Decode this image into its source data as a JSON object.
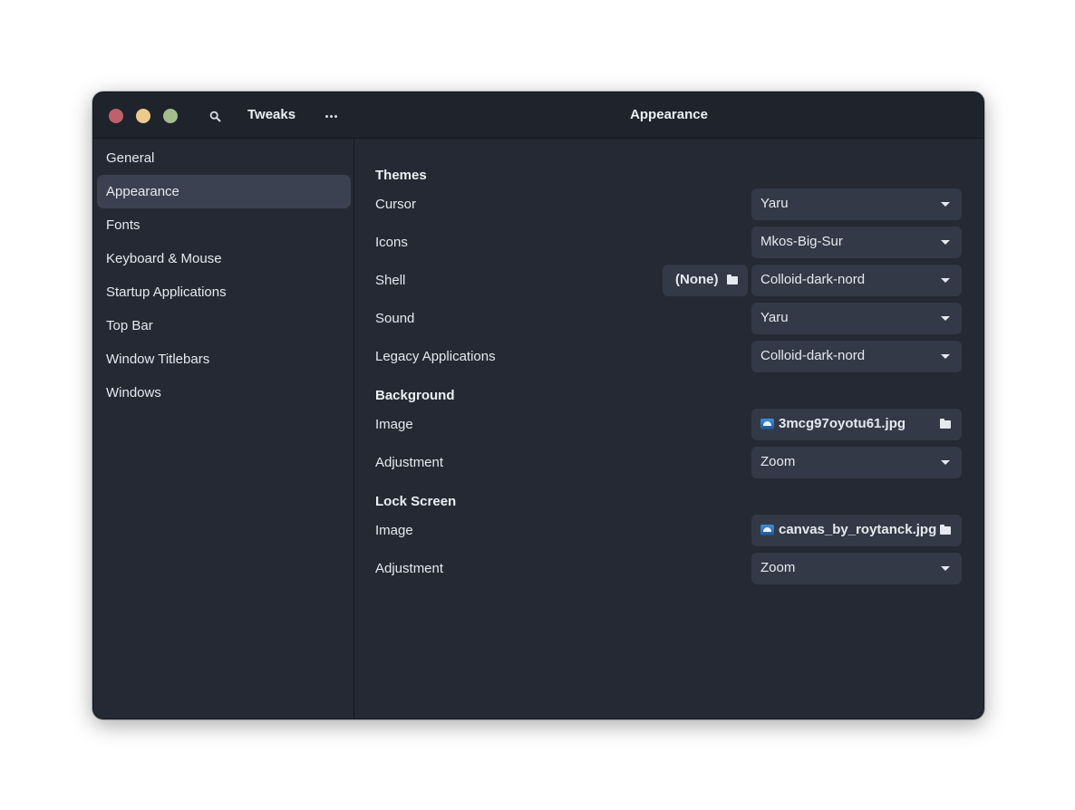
{
  "window": {
    "app_title": "Tweaks",
    "page_title": "Appearance"
  },
  "sidebar": {
    "items": [
      {
        "label": "General"
      },
      {
        "label": "Appearance"
      },
      {
        "label": "Fonts"
      },
      {
        "label": "Keyboard & Mouse"
      },
      {
        "label": "Startup Applications"
      },
      {
        "label": "Top Bar"
      },
      {
        "label": "Window Titlebars"
      },
      {
        "label": "Windows"
      }
    ],
    "selected": "Appearance"
  },
  "themes": {
    "heading": "Themes",
    "cursor": {
      "label": "Cursor",
      "value": "Yaru"
    },
    "icons": {
      "label": "Icons",
      "value": "Mkos-Big-Sur"
    },
    "shell": {
      "label": "Shell",
      "value": "Colloid-dark-nord",
      "file_button": "(None)"
    },
    "sound": {
      "label": "Sound",
      "value": "Yaru"
    },
    "legacy": {
      "label": "Legacy Applications",
      "value": "Colloid-dark-nord"
    }
  },
  "background": {
    "heading": "Background",
    "image": {
      "label": "Image",
      "value": "3mcg97oyotu61.jpg"
    },
    "adjustment": {
      "label": "Adjustment",
      "value": "Zoom"
    }
  },
  "lock_screen": {
    "heading": "Lock Screen",
    "image": {
      "label": "Image",
      "value": "canvas_by_roytanck.jpg"
    },
    "adjustment": {
      "label": "Adjustment",
      "value": "Zoom"
    }
  },
  "icons": {
    "search": "search-icon",
    "menu": "more-horizontal-icon",
    "dropdown": "pan-down-icon",
    "folder": "folder-icon",
    "image": "image-file-icon"
  },
  "colors": {
    "window_bg": "#242933",
    "titlebar_bg": "#1f232b",
    "selected_row": "#3b4150",
    "control_bg": "#333946",
    "close": "#bf616a",
    "minimize": "#ebcb8b",
    "maximize": "#a3be8c"
  }
}
